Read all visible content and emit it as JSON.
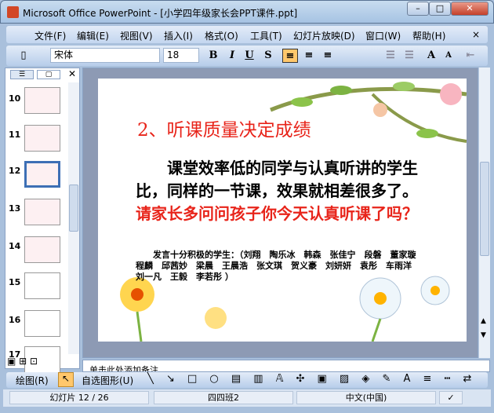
{
  "window": {
    "title": "Microsoft Office PowerPoint - [小学四年级家长会PPT课件.ppt]",
    "minimize": "–",
    "maximize": "□",
    "close": "✕"
  },
  "menu": {
    "items": [
      "文件(F)",
      "编辑(E)",
      "视图(V)",
      "插入(I)",
      "格式(O)",
      "工具(T)",
      "幻灯片放映(D)",
      "窗口(W)",
      "帮助(H)"
    ],
    "close": "×"
  },
  "toolbar": {
    "font": "宋体",
    "size": "18",
    "bold": "B",
    "italic": "I",
    "underline": "U",
    "shadow": "S",
    "grow": "A",
    "shrink": "A"
  },
  "slides_pane": {
    "numbers": [
      "10",
      "11",
      "12",
      "13",
      "14",
      "15",
      "16",
      "17"
    ],
    "selected": "12"
  },
  "slide": {
    "title": "2、听课质量决定成绩",
    "body_black": "课堂效率低的同学与认真听讲的学生比，同样的一节课，效果就相差很多了。",
    "body_red": "请家长多问问孩子你今天认真听课了吗？",
    "students": "发言十分积极的学生：（刘翔　陶乐冰　韩森　张佳宁　段磐　董家璇　程麟　邱茜妙　梁晨　王晨浩　张文琪　贺义豪　刘妍妍　袁彤　车雨洋　刘一凡　王毅　李若彤 ）"
  },
  "notes": {
    "placeholder": "单击此处添加备注"
  },
  "drawbar": {
    "draw": "绘图(R)",
    "autoshapes": "自选图形(U)"
  },
  "status": {
    "slide": "幻灯片 12 / 26",
    "design": "四四班2",
    "language": "中文(中国)"
  },
  "colors": {
    "title_red": "#e8241a",
    "accent": "#ffc76b"
  }
}
